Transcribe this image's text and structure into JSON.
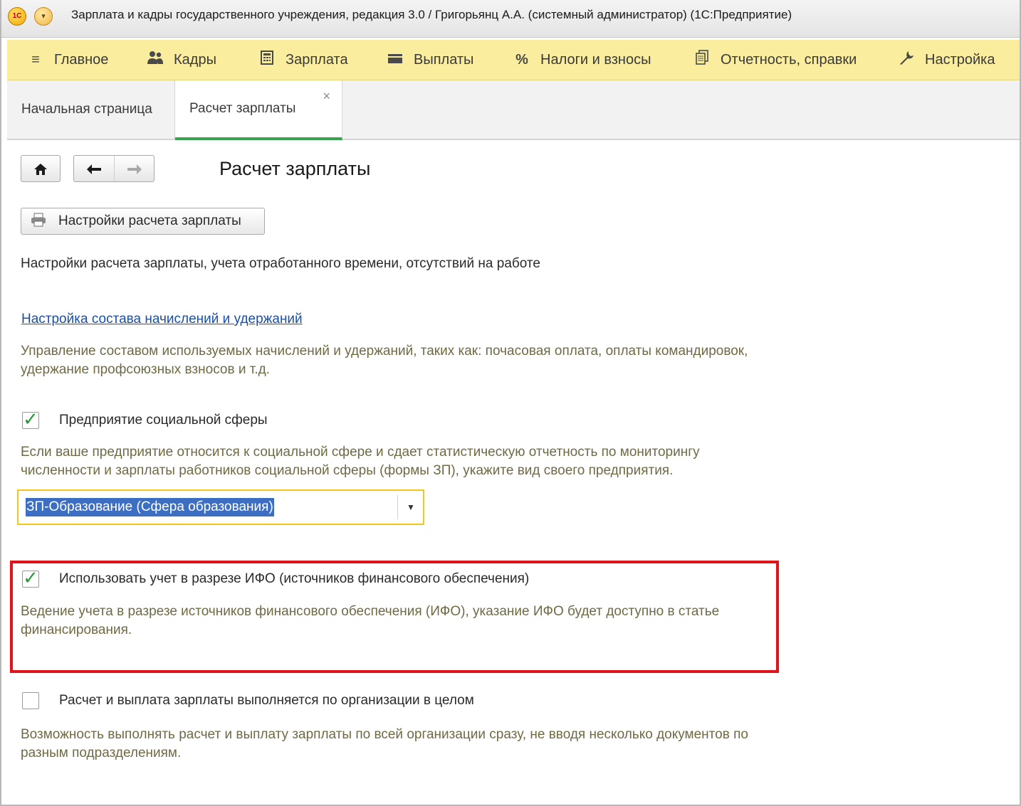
{
  "window": {
    "title": "Зарплата и кадры государственного учреждения, редакция 3.0 / Григорьянц А.А. (системный администратор)  (1С:Предприятие)",
    "logo_text": "1С"
  },
  "sections": [
    {
      "label": "Главное",
      "icon": "menu-lines-icon"
    },
    {
      "label": "Кадры",
      "icon": "people-icon"
    },
    {
      "label": "Зарплата",
      "icon": "calculator-icon"
    },
    {
      "label": "Выплаты",
      "icon": "wallet-icon"
    },
    {
      "label": "Налоги и взносы",
      "icon": "percent-icon"
    },
    {
      "label": "Отчетность, справки",
      "icon": "documents-icon"
    },
    {
      "label": "Настройка",
      "icon": "wrench-icon"
    }
  ],
  "tabs": {
    "start": "Начальная страница",
    "active": "Расчет зарплаты",
    "close_glyph": "×"
  },
  "page": {
    "title": "Расчет зарплаты",
    "settings_button": "Настройки расчета зарплаты",
    "settings_desc": "Настройки расчета зарплаты, учета отработанного времени, отсутствий на работе",
    "accruals_link": "Настройка состава начислений и удержаний",
    "accruals_desc_1": "Управление составом используемых начислений и удержаний, таких как: почасовая оплата, оплаты командировок,",
    "accruals_desc_2": "удержание профсоюзных взносов и т.д.",
    "social": {
      "checked": true,
      "label": "Предприятие социальной сферы",
      "desc_1": "Если ваше предприятие относится к социальной сфере и сдает статистическую отчетность по мониторингу",
      "desc_2": "численности и зарплаты работников социальной сферы (формы ЗП), укажите вид своего предприятия.",
      "select_value": "ЗП-Образование (Сфера образования)"
    },
    "ifo": {
      "checked": true,
      "label": "Использовать учет в разрезе ИФО (источников финансового обеспечения)",
      "desc_1": "Ведение учета в разрезе источников финансового обеспечения (ИФО), указание ИФО будет доступно в статье",
      "desc_2": "финансирования."
    },
    "org": {
      "checked": false,
      "label": "Расчет и выплата зарплаты выполняется по организации в целом",
      "desc_1": "Возможность выполнять расчет и выплату зарплаты по всей организации сразу, не вводя несколько документов по",
      "desc_2": "разным подразделениям."
    }
  },
  "colors": {
    "section_bar": "#fbed9e",
    "active_tab_underline": "#3aa24f",
    "hint_text": "#6f6a44",
    "link": "#1a4fa8",
    "highlight_frame": "#e0121a",
    "selection": "#3c6fc4"
  }
}
